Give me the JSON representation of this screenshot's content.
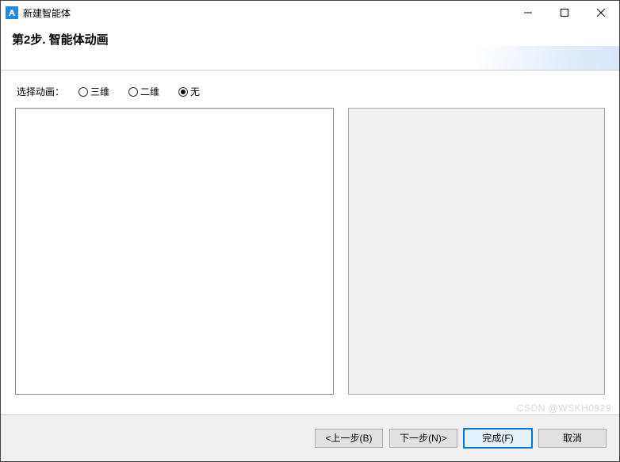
{
  "window": {
    "title": "新建智能体"
  },
  "header": {
    "step_title": "第2步. 智能体动画"
  },
  "content": {
    "choose_label": "选择动画：",
    "radios": {
      "three_d": "三维",
      "two_d": "二维",
      "none": "无"
    },
    "selected": "none"
  },
  "footer": {
    "back": "<上一步(B)",
    "next": "下一步(N)>",
    "finish": "完成(F)",
    "cancel": "取消"
  },
  "watermark": "CSDN @WSKH0929"
}
